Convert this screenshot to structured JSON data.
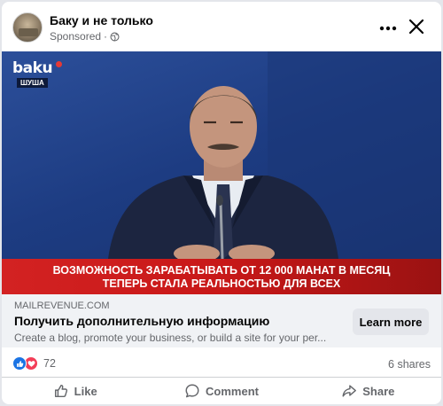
{
  "post": {
    "page_name": "Баку и не только",
    "sponsored_label": "Sponsored",
    "separator": "·"
  },
  "media": {
    "channel_logo": "baku",
    "location_badge": "ШУША",
    "caption_line1": "ВОЗМОЖНОСТЬ ЗАРАБАТЫВАТЬ ОТ 12 000 МАНАТ В МЕСЯЦ",
    "caption_line2": "ТЕПЕРЬ СТАЛА РЕАЛЬНОСТЬЮ ДЛЯ ВСЕХ",
    "caption_color": "#d32222"
  },
  "link": {
    "domain": "MAILREVENUE.COM",
    "headline": "Получить дополнительную информацию",
    "description": "Create a blog, promote your business, or build a site for your per...",
    "cta_label": "Learn more"
  },
  "stats": {
    "reaction_count": "72",
    "shares": "6 shares"
  },
  "actions": {
    "like": "Like",
    "comment": "Comment",
    "share": "Share"
  },
  "icons": [
    "more-icon",
    "close-icon",
    "globe-icon",
    "like-reaction-icon",
    "love-reaction-icon",
    "thumbs-up-icon",
    "comment-icon",
    "share-icon"
  ],
  "colors": {
    "like_blue": "#1b74e4",
    "love_red": "#f33e58",
    "secondary_text": "#65676b"
  }
}
